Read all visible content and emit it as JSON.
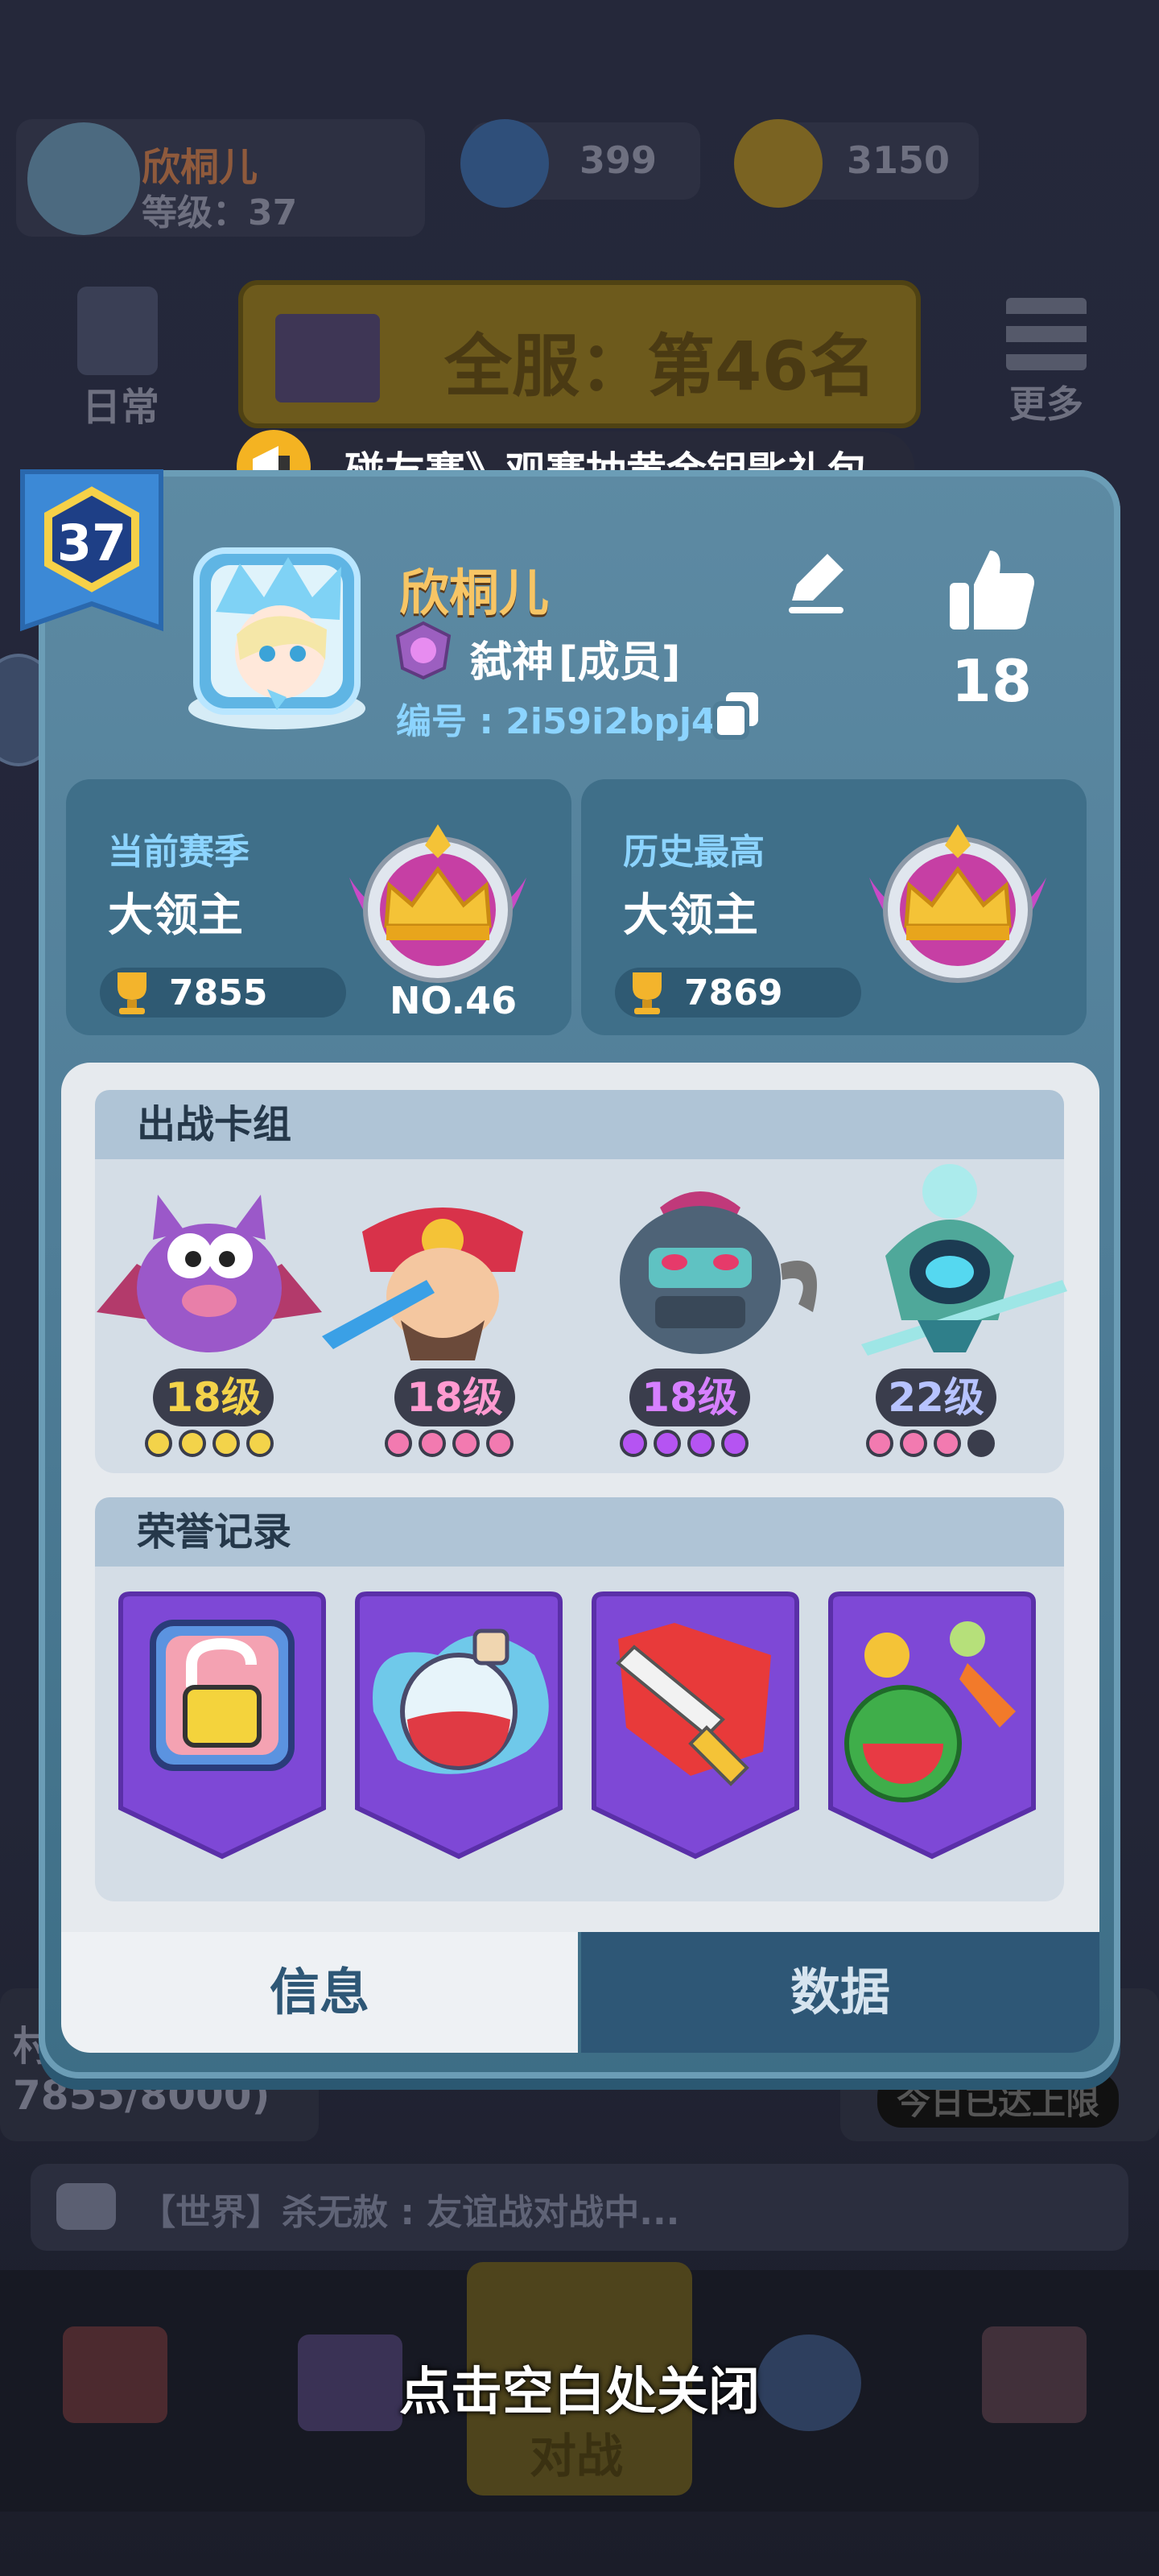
{
  "topbar": {
    "player_name": "欣桐儿",
    "level_text": "等级：37",
    "gems": "399",
    "coins": "3150"
  },
  "left_nav": {
    "daily_label": "日常"
  },
  "right_nav": {
    "more_label": "更多"
  },
  "server_rank_banner": "全服：第46名",
  "marquee_text": "碰友赛》观赛抽黄金钥匙礼包",
  "profile": {
    "level": "37",
    "name": "欣桐儿",
    "guild_name": "弑神",
    "guild_role": "[成员]",
    "id_label": "编号 : 2i59i2bpj4",
    "likes": "18"
  },
  "current_season": {
    "label": "当前赛季",
    "rank": "大领主",
    "trophies": "7855",
    "position": "NO.46"
  },
  "history_best": {
    "label": "历史最高",
    "rank": "大领主",
    "trophies": "7869"
  },
  "deck": {
    "title": "出战卡组",
    "cards": [
      {
        "name": "bat",
        "level": "18级",
        "level_color": "#f3d34a",
        "dot_color": "#f3d34a",
        "dots_filled": 4
      },
      {
        "name": "samurai",
        "level": "18级",
        "level_color": "#ff9ad0",
        "dot_color": "#f27ab0",
        "dots_filled": 4
      },
      {
        "name": "ogre",
        "level": "18级",
        "level_color": "#d680ff",
        "dot_color": "#b554f2",
        "dots_filled": 4
      },
      {
        "name": "ghost-knight",
        "level": "22级",
        "level_color": "#b7c3ff",
        "dot_color": "#f27ab0",
        "dots_filled": 3
      }
    ]
  },
  "honor": {
    "title": "荣誉记录",
    "badges": [
      "lock-badge",
      "potion-badge",
      "sword-badge",
      "fruit-badge"
    ]
  },
  "tabs": {
    "info": "信息",
    "data": "数据"
  },
  "background": {
    "progress_text": "7855/8000)",
    "progress_prefix": "村",
    "chat_text": "【世界】杀无赦 : 友谊战对战中...",
    "limit_text": "今日已达上限",
    "battle_label": "对战"
  },
  "close_hint": "点击空白处关闭",
  "colors": {
    "card_bg": "#4f7d97",
    "name_gold": "#f7c565",
    "id_cyan": "#8cd4ff",
    "tab_active": "#eef1f4",
    "tab_inactive": "#2e5776"
  }
}
